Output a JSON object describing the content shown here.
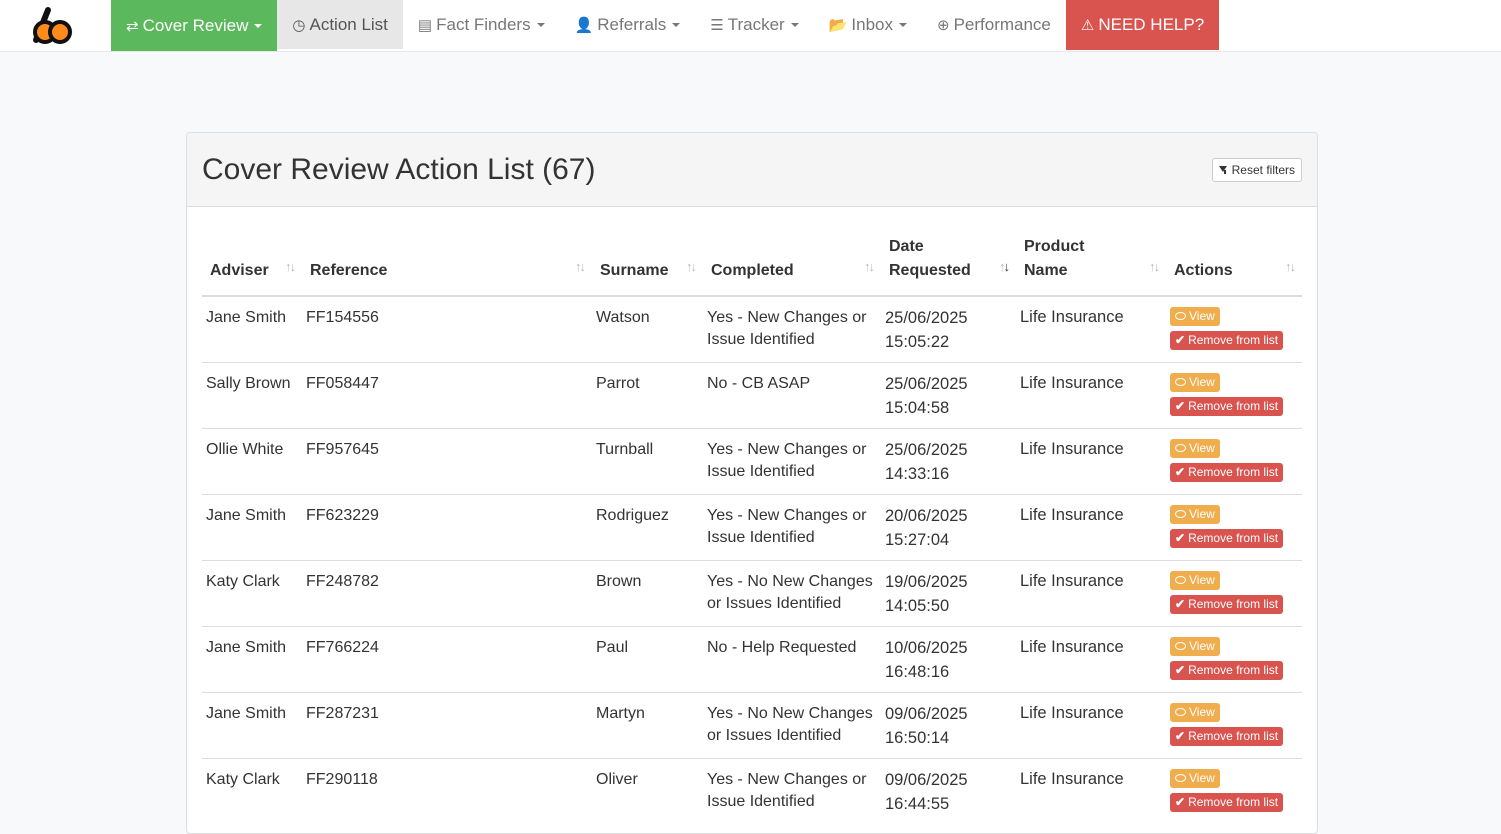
{
  "nav": {
    "items": [
      {
        "label": "Cover Review",
        "icon": "exchange-arrows-icon",
        "glyph": "⇄",
        "caret": true,
        "style": "active-green"
      },
      {
        "label": "Action List",
        "icon": "dashboard-icon",
        "glyph": "◷",
        "caret": false,
        "style": "active-grey"
      },
      {
        "label": "Fact Finders",
        "icon": "list-alt-icon",
        "glyph": "▤",
        "caret": true,
        "style": ""
      },
      {
        "label": "Referrals",
        "icon": "user-icon",
        "glyph": "👤",
        "caret": true,
        "style": ""
      },
      {
        "label": "Tracker",
        "icon": "list-icon",
        "glyph": "☰",
        "caret": true,
        "style": ""
      },
      {
        "label": "Inbox",
        "icon": "folder-open-icon",
        "glyph": "📂",
        "caret": true,
        "style": ""
      },
      {
        "label": "Performance",
        "icon": "download-circle-icon",
        "glyph": "⊕",
        "caret": false,
        "style": ""
      },
      {
        "label": "NEED HELP?",
        "icon": "warning-icon",
        "glyph": "⚠",
        "caret": false,
        "style": "help"
      }
    ]
  },
  "panel": {
    "title": "Cover Review Action List (67)",
    "reset_label": "Reset filters"
  },
  "table": {
    "headers": {
      "adviser": "Adviser",
      "reference": "Reference",
      "surname": "Surname",
      "completed": "Completed",
      "date": "Date Requested",
      "product": "Product Name",
      "actions": "Actions"
    },
    "sort_glyph": "↑↓",
    "view_label": "View",
    "remove_label": "Remove from list",
    "rows": [
      {
        "adviser": "Jane Smith",
        "reference": "FF154556",
        "surname": "Watson",
        "completed": "Yes - New Changes or Issue Identified",
        "date": "25/06/2025 15:05:22",
        "product": "Life Insurance"
      },
      {
        "adviser": "Sally Brown",
        "reference": "FF058447",
        "surname": "Parrot",
        "completed": "No - CB ASAP",
        "date": "25/06/2025 15:04:58",
        "product": "Life Insurance"
      },
      {
        "adviser": "Ollie White",
        "reference": "FF957645",
        "surname": "Turnball",
        "completed": "Yes - New Changes or Issue Identified",
        "date": "25/06/2025 14:33:16",
        "product": "Life Insurance"
      },
      {
        "adviser": "Jane Smith",
        "reference": "FF623229",
        "surname": "Rodriguez",
        "completed": "Yes - New Changes or Issue Identified",
        "date": "20/06/2025 15:27:04",
        "product": "Life Insurance"
      },
      {
        "adviser": "Katy Clark",
        "reference": "FF248782",
        "surname": "Brown",
        "completed": "Yes - No New Changes or Issues Identified",
        "date": "19/06/2025 14:05:50",
        "product": "Life Insurance"
      },
      {
        "adviser": "Jane Smith",
        "reference": "FF766224",
        "surname": "Paul",
        "completed": "No - Help Requested",
        "date": "10/06/2025 16:48:16",
        "product": "Life Insurance"
      },
      {
        "adviser": "Jane Smith",
        "reference": "FF287231",
        "surname": "Martyn",
        "completed": "Yes - No New Changes or Issues Identified",
        "date": "09/06/2025 16:50:14",
        "product": "Life Insurance"
      },
      {
        "adviser": "Katy Clark",
        "reference": "FF290118",
        "surname": "Oliver",
        "completed": "Yes - New Changes or Issue Identified",
        "date": "09/06/2025 16:44:55",
        "product": "Life Insurance"
      }
    ]
  },
  "colors": {
    "accent_green": "#5cb85c",
    "help_red": "#d9534f",
    "view_orange": "#f0ad4e",
    "logo_orange": "#ff8c1a"
  }
}
